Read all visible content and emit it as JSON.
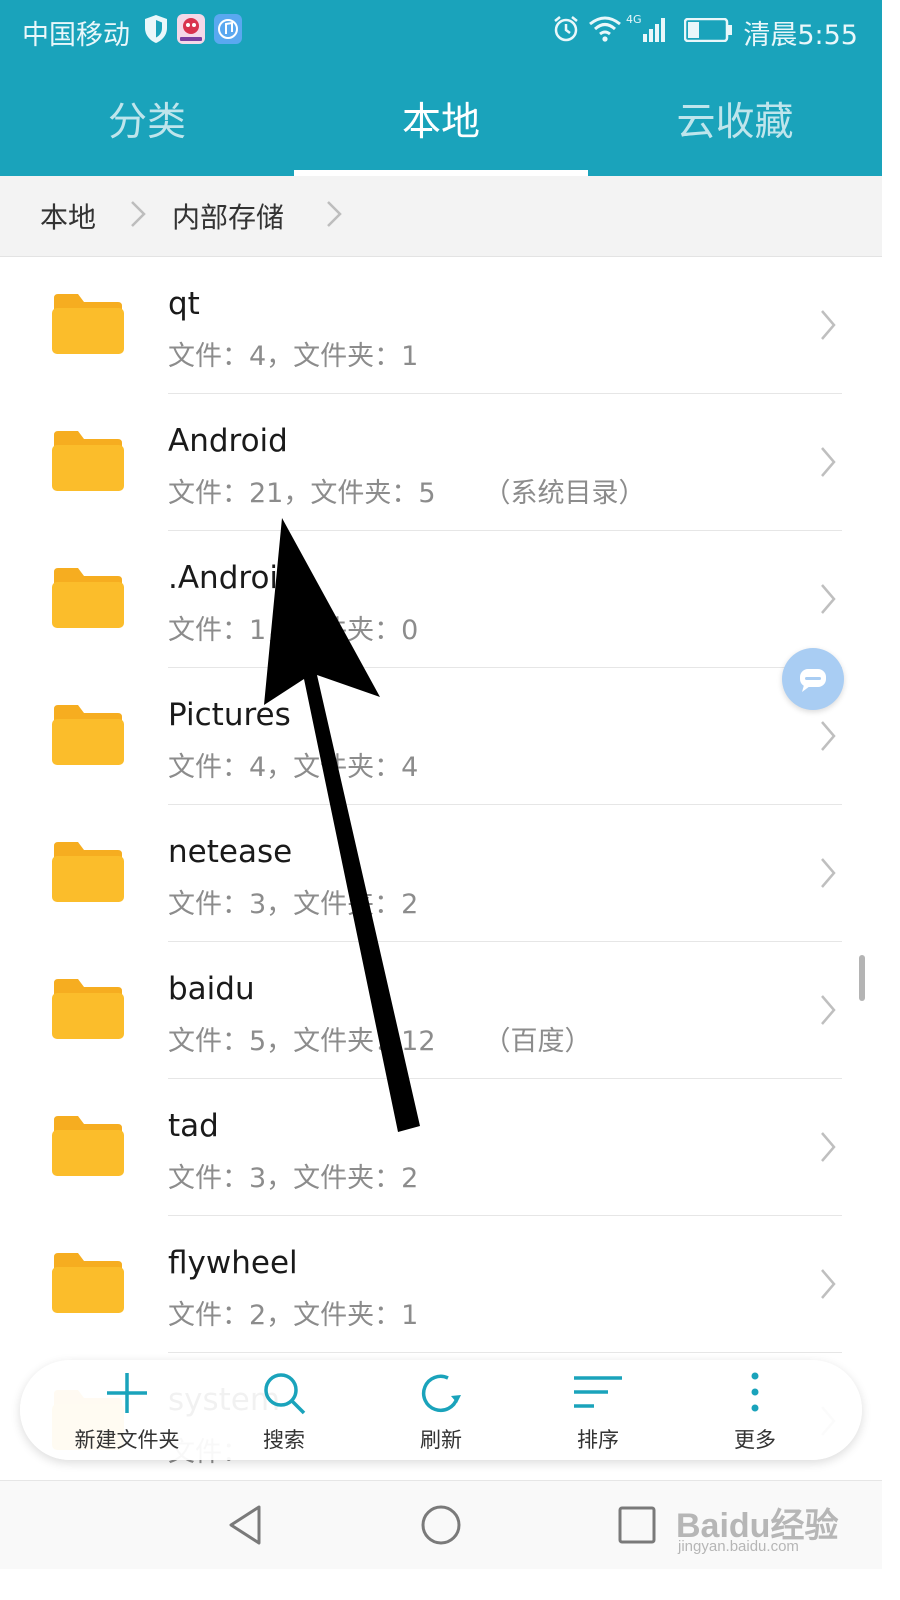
{
  "status_bar": {
    "carrier": "中国移动",
    "time": "清晨5:55",
    "network": "4G",
    "icons": [
      "shield-icon",
      "chat-app-icon",
      "music-app-icon",
      "alarm-icon",
      "wifi-icon",
      "signal-icon",
      "battery-icon"
    ],
    "battery_level": 0.3
  },
  "tabs": [
    {
      "label": "分类",
      "active": false
    },
    {
      "label": "本地",
      "active": true
    },
    {
      "label": "云收藏",
      "active": false
    }
  ],
  "breadcrumb": [
    "本地",
    "内部存储"
  ],
  "files": [
    {
      "name": "qt",
      "meta": "文件：4，文件夹：1",
      "tag": ""
    },
    {
      "name": "Android",
      "meta": "文件：21，文件夹：5",
      "tag": "（系统目录）"
    },
    {
      "name": ".Android",
      "meta": "文件：1，文件夹：0",
      "tag": ""
    },
    {
      "name": "Pictures",
      "meta": "文件：4，文件夹：4",
      "tag": ""
    },
    {
      "name": "netease",
      "meta": "文件：3，文件夹：2",
      "tag": ""
    },
    {
      "name": "baidu",
      "meta": "文件：5，文件夹：12",
      "tag": "（百度）"
    },
    {
      "name": "tad",
      "meta": "文件：3，文件夹：2",
      "tag": ""
    },
    {
      "name": "flywheel",
      "meta": "文件：2，文件夹：1",
      "tag": ""
    },
    {
      "name": "system",
      "meta": "文件：",
      "tag": ""
    }
  ],
  "toolbar": [
    {
      "label": "新建文件夹",
      "icon": "plus-icon"
    },
    {
      "label": "搜索",
      "icon": "search-icon"
    },
    {
      "label": "刷新",
      "icon": "refresh-icon"
    },
    {
      "label": "排序",
      "icon": "sort-icon"
    },
    {
      "label": "更多",
      "icon": "more-icon"
    }
  ],
  "nav_bar": [
    "back-icon",
    "home-icon",
    "recents-icon"
  ],
  "watermark": {
    "logo": "Baidu经验",
    "url": "jingyan.baidu.com"
  },
  "colors": {
    "primary": "#1aa3bb",
    "folder": "#fbbd2b",
    "accent": "#1aa3bb",
    "float_button": "#a9cdf3"
  }
}
